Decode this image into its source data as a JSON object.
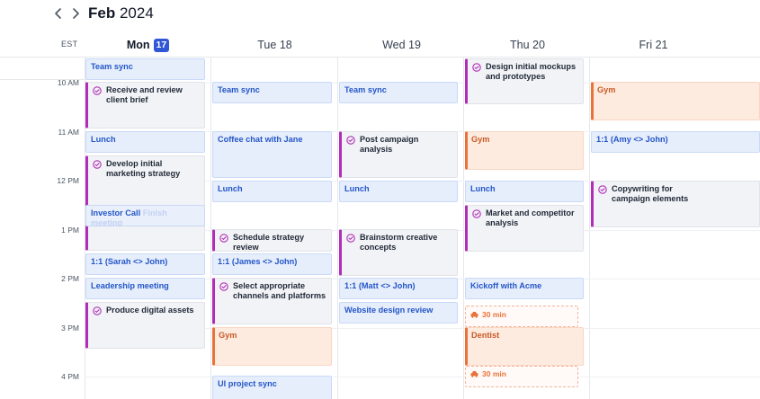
{
  "header": {
    "month": "Feb",
    "year": "2024",
    "timezone": "EST",
    "prev_icon": "chevron-left-icon",
    "next_icon": "chevron-right-icon"
  },
  "days": [
    {
      "name": "Mon",
      "date": "17",
      "today": true
    },
    {
      "name": "Tue 18",
      "today": false
    },
    {
      "name": "Wed 19",
      "today": false
    },
    {
      "name": "Thu 20",
      "today": false
    },
    {
      "name": "Fri 21",
      "today": false
    }
  ],
  "hours": [
    "10 AM",
    "11 AM",
    "12 PM",
    "1 PM",
    "2 PM",
    "3 PM",
    "4 PM"
  ],
  "colors": {
    "accent": "#3157d6",
    "meeting_bg": "#e6eefc",
    "meeting_text": "#2456c7",
    "task_bar": "#b12db8",
    "personal_bar": "#e8733a",
    "personal_bg": "#fdebe0"
  },
  "events": {
    "mon": {
      "team_sync": "Team sync",
      "receive_brief": "Receive and review client brief",
      "lunch": "Lunch",
      "develop_strategy": "Develop initial marketing strategy",
      "investor_call": "Investor Call",
      "investor_call_overlap": "Finish meeting",
      "one_on_one": "1:1 (Sarah <> John)",
      "leadership": "Leadership meeting",
      "produce_assets": "Produce digital assets"
    },
    "tue": {
      "team_sync": "Team sync",
      "coffee_chat": "Coffee chat with Jane",
      "lunch": "Lunch",
      "schedule_review": "Schedule strategy review",
      "one_on_one": "1:1 (James <> John)",
      "select_channels": "Select appropriate channels and platforms",
      "gym": "Gym",
      "ui_sync": "UI project sync"
    },
    "wed": {
      "team_sync": "Team sync",
      "post_campaign": "Post campaign analysis",
      "lunch": "Lunch",
      "brainstorm": "Brainstorm creative concepts",
      "one_on_one": "1:1 (Matt <> John)",
      "website_review": "Website design review"
    },
    "thu": {
      "design_mockups": "Design initial mockups and prototypes",
      "gym": "Gym",
      "lunch": "Lunch",
      "market_analysis": "Market and competitor analysis",
      "kickoff": "Kickoff with Acme",
      "travel_before": "30 min",
      "dentist": "Dentist",
      "travel_after": "30 min"
    },
    "fri": {
      "gym": "Gym",
      "one_on_one": "1:1 (Amy <> John)",
      "copywriting": "Copywriting for campaign elements"
    }
  }
}
